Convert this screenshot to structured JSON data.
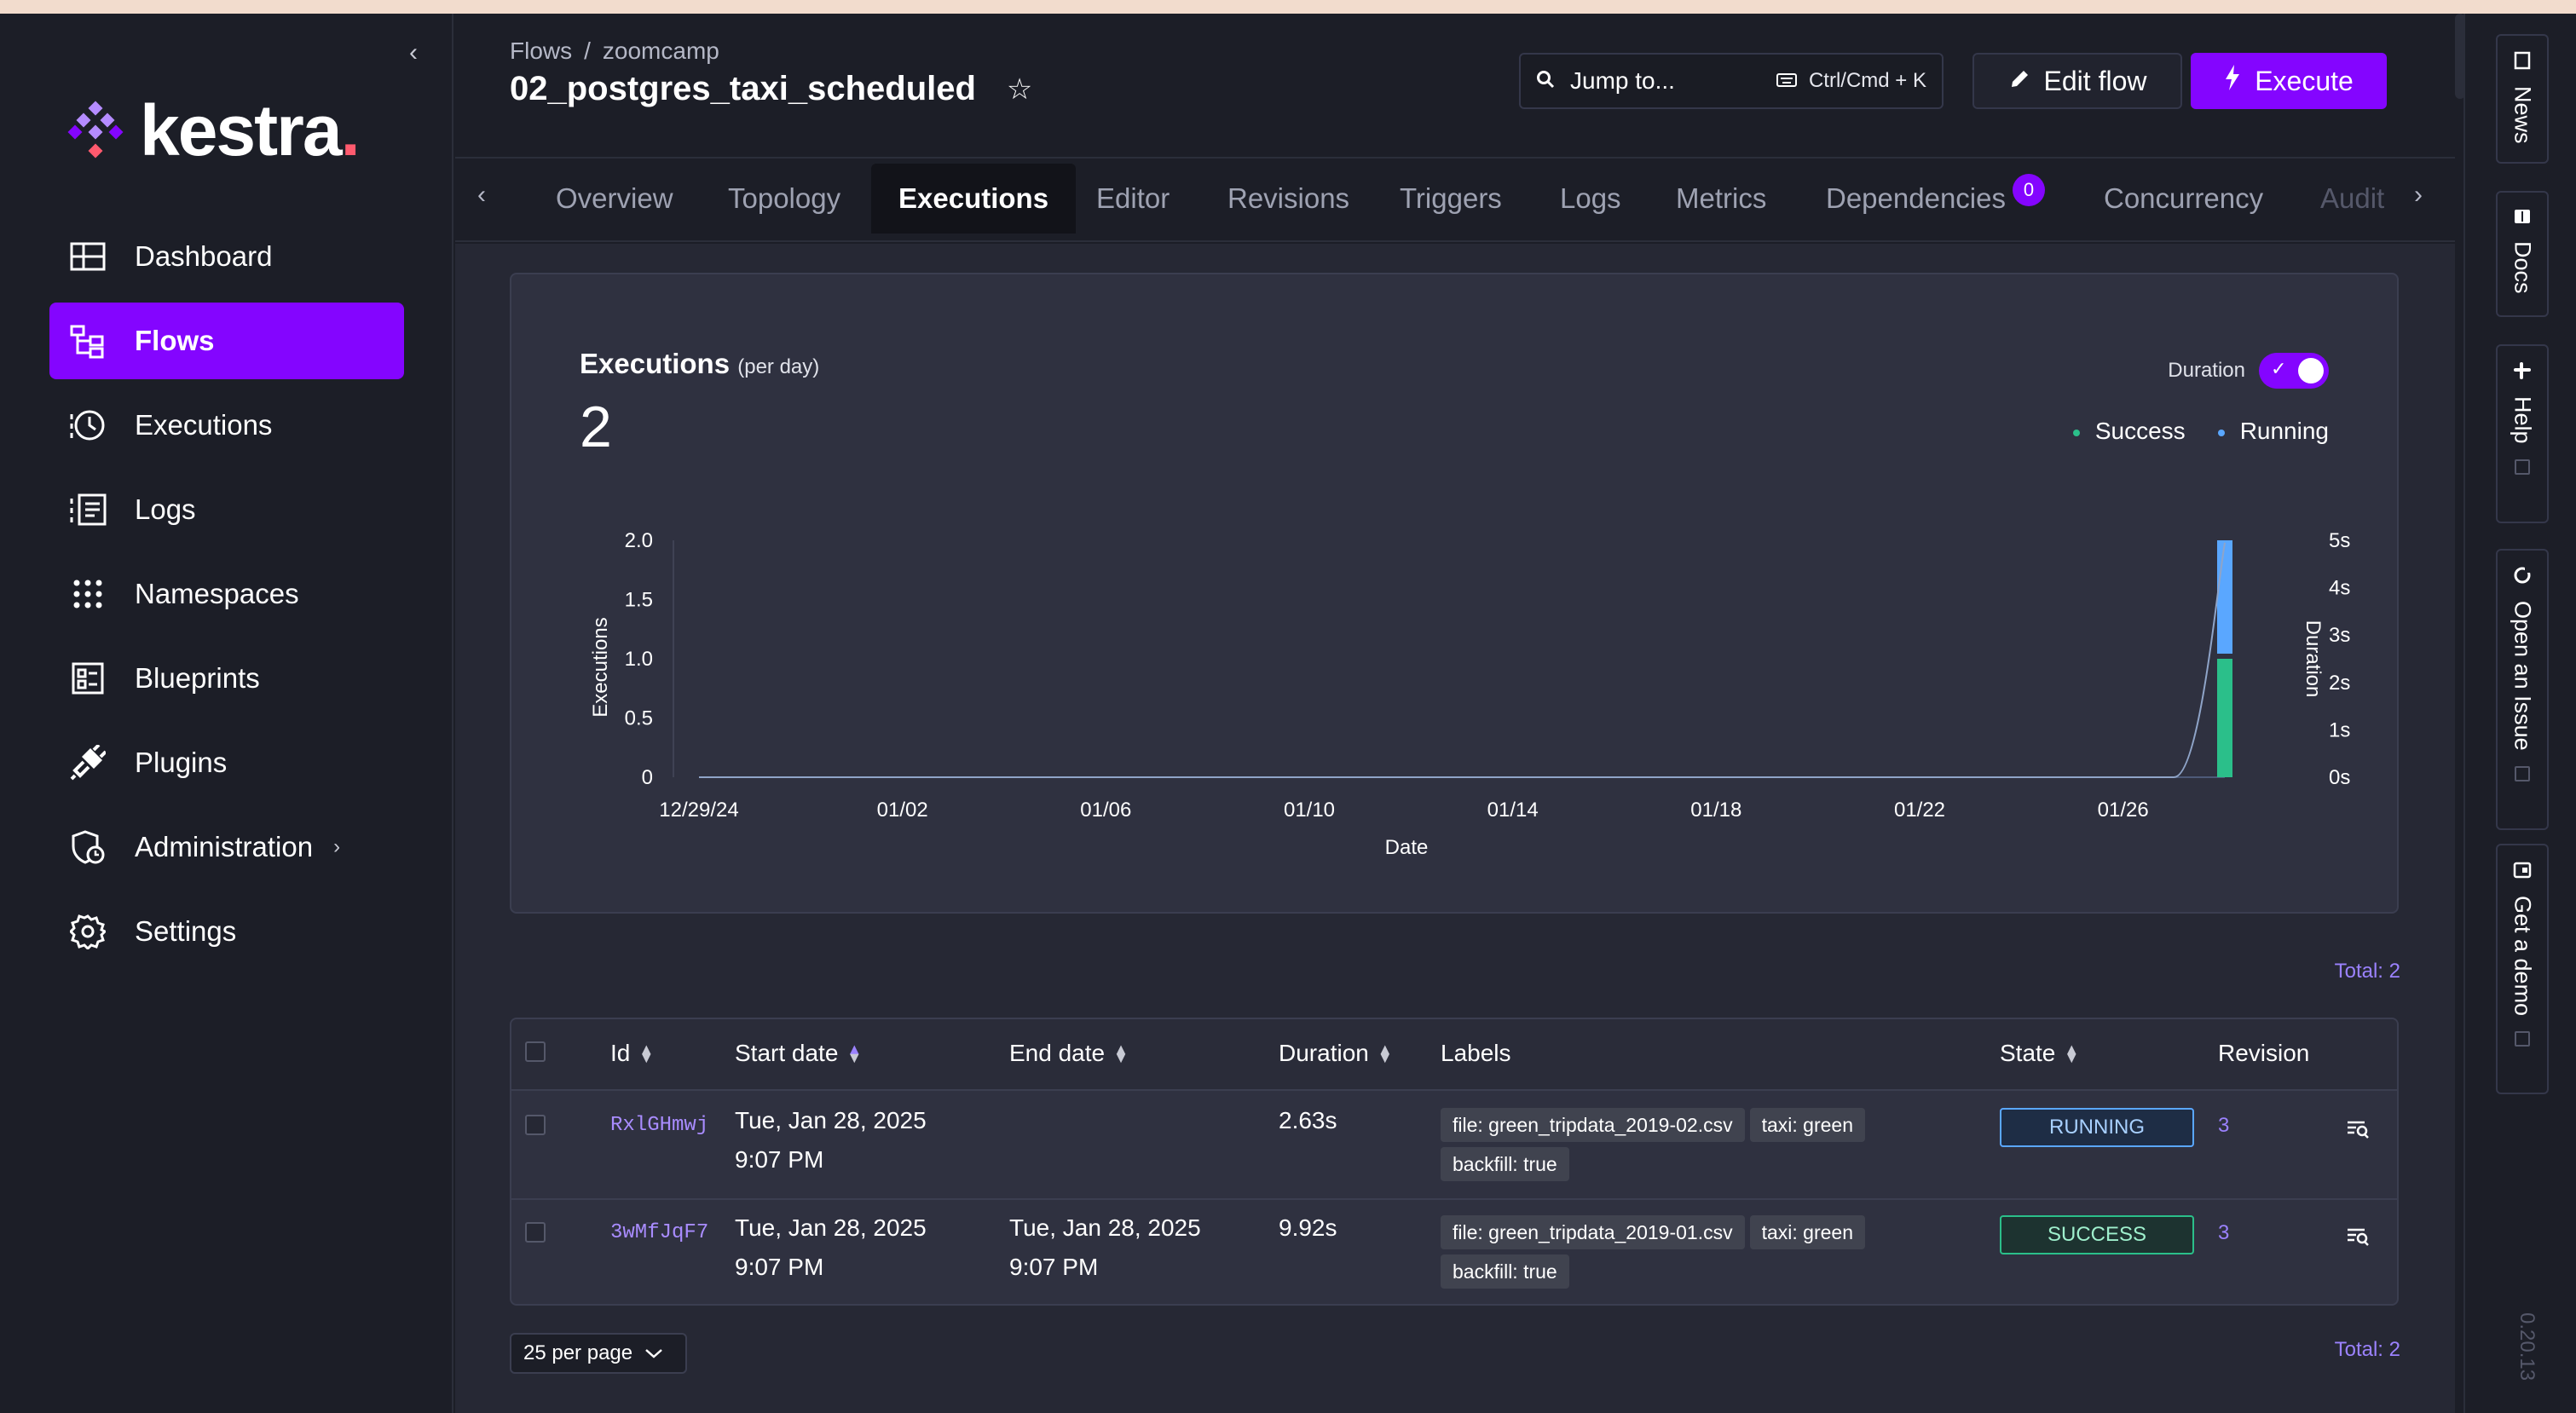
{
  "sidebar": {
    "logo_text": "kestra",
    "logo_dot": ".",
    "items": [
      {
        "label": "Dashboard"
      },
      {
        "label": "Flows"
      },
      {
        "label": "Executions"
      },
      {
        "label": "Logs"
      },
      {
        "label": "Namespaces"
      },
      {
        "label": "Blueprints"
      },
      {
        "label": "Plugins"
      },
      {
        "label": "Administration"
      },
      {
        "label": "Settings"
      }
    ]
  },
  "header": {
    "breadcrumb": [
      "Flows",
      "zoomcamp"
    ],
    "breadcrumb_sep": "/",
    "title": "02_postgres_taxi_scheduled",
    "jump_label": "Jump to...",
    "jump_shortcut": "Ctrl/Cmd + K",
    "edit_label": "Edit flow",
    "execute_label": "Execute"
  },
  "tabs": [
    {
      "label": "Overview"
    },
    {
      "label": "Topology"
    },
    {
      "label": "Executions"
    },
    {
      "label": "Editor"
    },
    {
      "label": "Revisions"
    },
    {
      "label": "Triggers"
    },
    {
      "label": "Logs"
    },
    {
      "label": "Metrics"
    },
    {
      "label": "Dependencies",
      "badge": "0"
    },
    {
      "label": "Concurrency"
    },
    {
      "label": "Audit"
    }
  ],
  "chart": {
    "title": "Executions",
    "subtitle": "(per day)",
    "total": "2",
    "duration_toggle_label": "Duration",
    "legend": [
      "Success",
      "Running"
    ]
  },
  "chart_data": {
    "type": "bar",
    "title": "Executions",
    "subtitle": "(per day)",
    "xlabel": "Date",
    "ylabel": "Executions",
    "y2label": "Duration",
    "xticks": [
      "12/29/24",
      "01/02",
      "01/06",
      "01/10",
      "01/14",
      "01/18",
      "01/22",
      "01/26"
    ],
    "yticks": [
      "0",
      "0.5",
      "1.0",
      "1.5",
      "2.0"
    ],
    "y2ticks": [
      "0s",
      "1s",
      "2s",
      "3s",
      "4s",
      "5s"
    ],
    "ylim": [
      0,
      2
    ],
    "y2lim": [
      0,
      5
    ],
    "x_start": "2024-12-29",
    "x_end": "2025-01-28",
    "colors": {
      "Success": "#2bbf8a",
      "Running": "#5aa7ff",
      "duration": "#8fa4c8"
    },
    "series": [
      {
        "name": "Success",
        "values": [
          {
            "x": "2025-01-28",
            "y": 1
          }
        ]
      },
      {
        "name": "Running",
        "values": [
          {
            "x": "2025-01-28",
            "y": 1
          }
        ]
      },
      {
        "name": "Duration",
        "values": [
          {
            "x": "2025-01-27",
            "y": 0
          },
          {
            "x": "2025-01-28",
            "y": 4.95
          }
        ]
      }
    ]
  },
  "table": {
    "total_label": "Total: 2",
    "columns": [
      "Id",
      "Start date",
      "End date",
      "Duration",
      "Labels",
      "State",
      "Revision"
    ],
    "rows": [
      {
        "id": "RxlGHmwj",
        "start_date": "Tue, Jan 28, 2025",
        "start_time": "9:07 PM",
        "end_date": "",
        "end_time": "",
        "duration": "2.63s",
        "labels": [
          "file: green_tripdata_2019-02.csv",
          "taxi: green",
          "backfill: true"
        ],
        "state": "RUNNING",
        "revision": "3"
      },
      {
        "id": "3wMfJqF7",
        "start_date": "Tue, Jan 28, 2025",
        "start_time": "9:07 PM",
        "end_date": "Tue, Jan 28, 2025",
        "end_time": "9:07 PM",
        "duration": "9.92s",
        "labels": [
          "file: green_tripdata_2019-01.csv",
          "taxi: green",
          "backfill: true"
        ],
        "state": "SUCCESS",
        "revision": "3"
      }
    ]
  },
  "pagination": {
    "per_page": "25 per page",
    "total_label": "Total: 2"
  },
  "rail": {
    "items": [
      "News",
      "Docs",
      "Help",
      "Open an Issue",
      "Get a demo"
    ],
    "version": "0.20.13"
  }
}
